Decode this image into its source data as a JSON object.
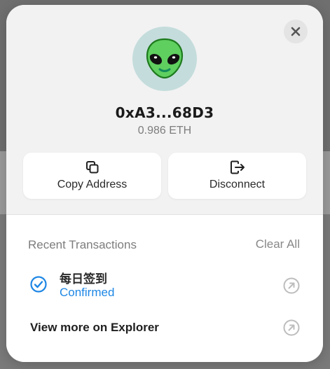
{
  "account": {
    "avatar_icon": "alien-emoji",
    "address": "0xA3...68D3",
    "balance": "0.986 ETH"
  },
  "actions": {
    "copy_label": "Copy Address",
    "copy_icon": "copy-icon",
    "disconnect_label": "Disconnect",
    "disconnect_icon": "logout-icon"
  },
  "close_icon": "close-icon",
  "transactions": {
    "title": "Recent Transactions",
    "clear_label": "Clear All",
    "items": [
      {
        "title": "每日签到",
        "status": "Confirmed",
        "status_icon": "check-circle-icon",
        "link_icon": "external-link-icon"
      }
    ],
    "explorer_label": "View more on Explorer"
  },
  "colors": {
    "accent": "#1e87e5",
    "avatar_bg": "#c4dcdc"
  }
}
